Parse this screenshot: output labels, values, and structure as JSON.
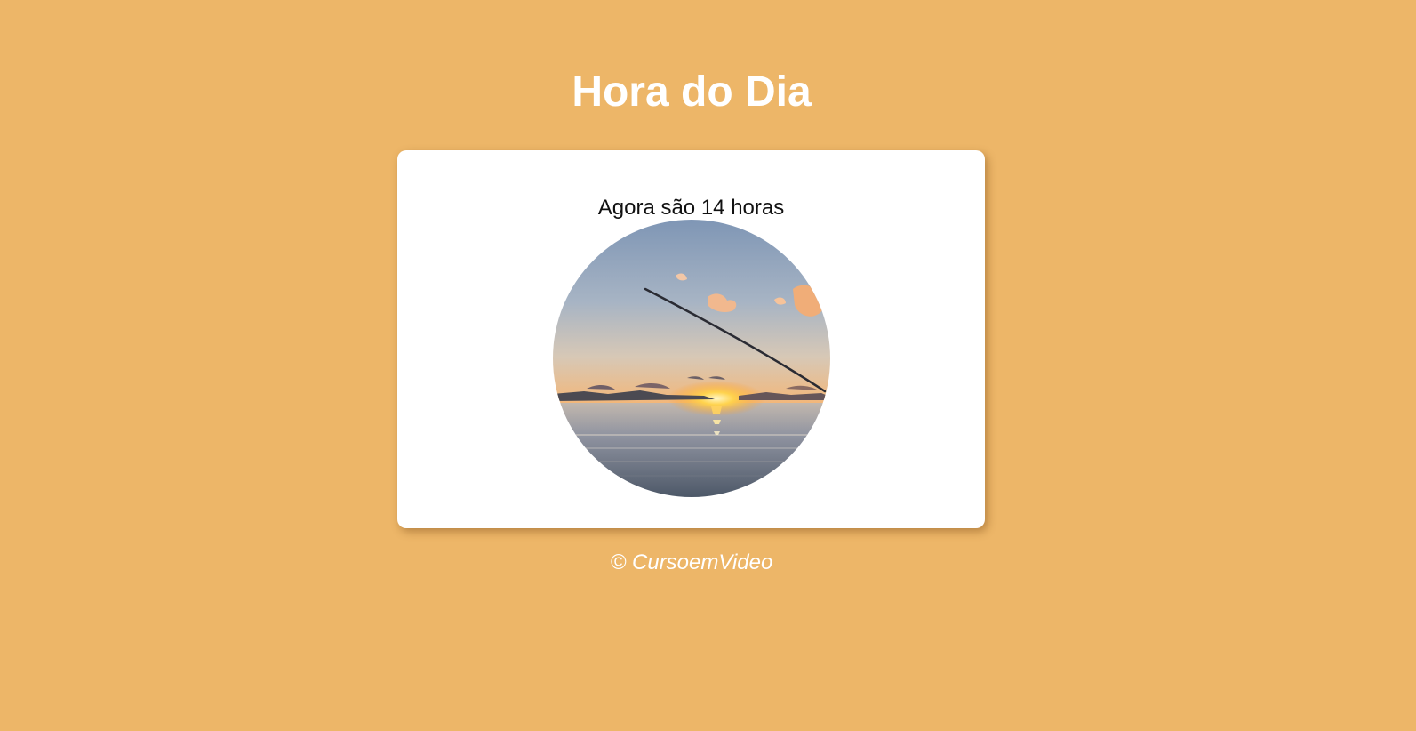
{
  "header": {
    "title": "Hora do Dia"
  },
  "card": {
    "message": "Agora são 14 horas"
  },
  "footer": {
    "copyright": "© CursoemVideo"
  },
  "colors": {
    "background": "#edb668",
    "card": "#ffffff",
    "title": "#ffffff"
  },
  "image": {
    "subject": "sunset-fishing-photo"
  }
}
